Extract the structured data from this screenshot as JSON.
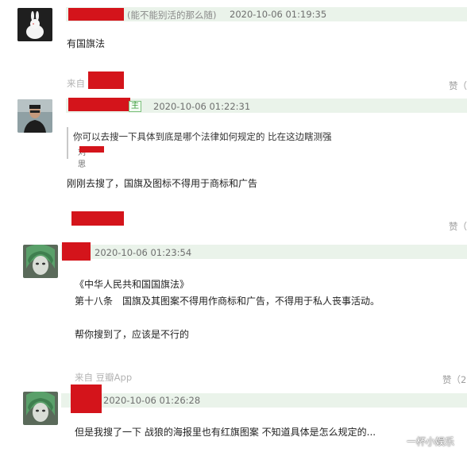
{
  "comments": [
    {
      "username_suffix": "(能不能别活的那么随)",
      "timestamp": "2020-10-06 01:19:35",
      "body": "有国旗法",
      "from_prefix": "来自",
      "like_label": "赞（"
    },
    {
      "tag": "主",
      "timestamp": "2020-10-06 01:22:31",
      "quote_text": "你可以去搜一下具体到底是哪个法律如何规定的 比在这边瞎测强",
      "quote_author_fragment": "刘思",
      "body": "刚刚去搜了，国旗及图标不得用于商标和广告",
      "like_label": "赞（"
    },
    {
      "timestamp": "2020-10-06 01:23:54",
      "body_lines": [
        "《中华人民共和国国旗法》",
        "第十八条　国旗及其图案不得用作商标和广告，不得用于私人丧事活动。",
        "",
        "帮你搜到了，应该是不行的"
      ],
      "from_label": "来自 豆瓣App",
      "like_label": "赞（2"
    },
    {
      "timestamp": "2020-10-06 01:26:28",
      "body": "但是我搜了一下 战狼的海报里也有红旗图案 不知道具体是怎么规定的..."
    }
  ],
  "watermark": "一杯小娱乐",
  "colors": {
    "redaction": "#d4141b",
    "header_band": "#eaf3ea",
    "tag_green": "#3a9a3a"
  }
}
